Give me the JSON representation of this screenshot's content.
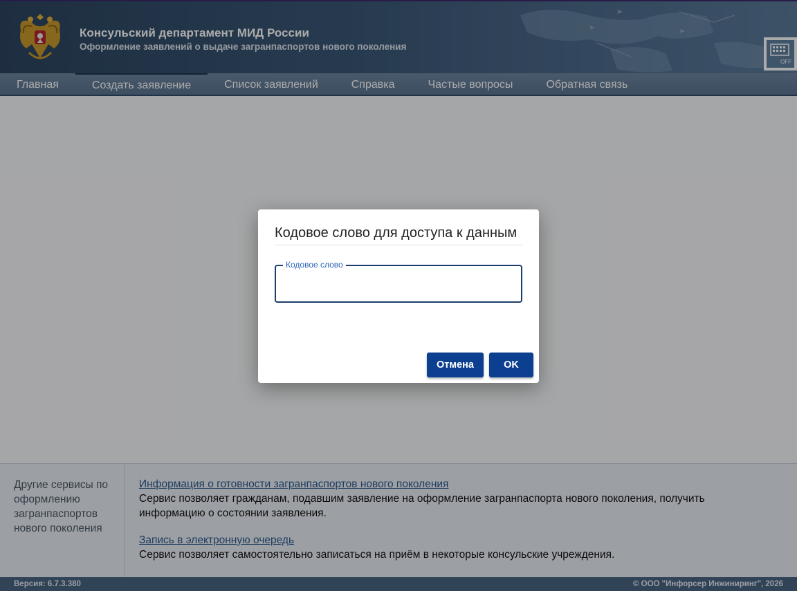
{
  "header": {
    "title": "Консульский департамент МИД России",
    "subtitle": "Оформление заявлений о выдаче загранпаспортов нового поколения",
    "keyboard_badge": "OFF"
  },
  "nav": {
    "items": [
      {
        "label": "Главная"
      },
      {
        "label": "Создать заявление"
      },
      {
        "label": "Список заявлений"
      },
      {
        "label": "Справка"
      },
      {
        "label": "Частые вопросы"
      },
      {
        "label": "Обратная связь"
      }
    ]
  },
  "dialog": {
    "title": "Кодовое слово для доступа к данным",
    "field_label": "Кодовое слово",
    "field_value": "",
    "cancel_label": "Отмена",
    "ok_label": "OK"
  },
  "footer": {
    "left_text": "Другие сервисы по оформлению загранпаспортов нового поколения",
    "services": [
      {
        "link": "Информация о готовности загранпаспортов нового поколения",
        "description": "Сервис позволяет гражданам, подавшим заявление на оформление загранпаспорта нового поколения, получить информацию о состоянии заявления."
      },
      {
        "link": "Запись в электронную очередь",
        "description": "Сервис позволяет самостоятельно записаться на приём в некоторые консульские учреждения."
      }
    ],
    "version": "Версия: 6.7.3.380",
    "copyright": "© ООО \"Инфорсер Инжиниринг\", 2026"
  },
  "colors": {
    "header_bg": "#3b5878",
    "nav_bg": "#6d86a0",
    "primary_button": "#0d3f91",
    "field_border": "#1b3d6c",
    "field_label": "#2f65b8",
    "link": "#2f5a8e"
  },
  "icons": [
    "state-emblem-icon",
    "virtual-keyboard-icon"
  ]
}
